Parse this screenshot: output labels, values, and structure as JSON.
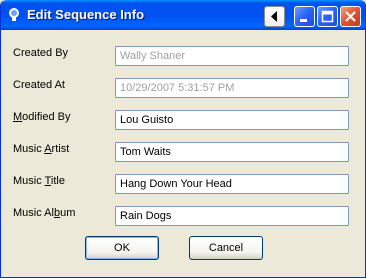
{
  "window": {
    "title": "Edit Sequence Info"
  },
  "titlebar_buttons": {
    "back_icon": "back-arrow-icon",
    "minimize_icon": "minimize-icon",
    "maximize_icon": "maximize-icon",
    "close_icon": "close-icon"
  },
  "fields": {
    "created_by": {
      "label": "Created By",
      "value": "Wally Shaner"
    },
    "created_at": {
      "label": "Created At",
      "value": "10/29/2007 5:31:57 PM"
    },
    "modified_by": {
      "label_pre": "",
      "label_key": "M",
      "label_post": "odified By",
      "value": "Lou Guisto"
    },
    "music_artist": {
      "label_pre": "Music ",
      "label_key": "A",
      "label_post": "rtist",
      "value": "Tom Waits"
    },
    "music_title": {
      "label_pre": "Music ",
      "label_key": "T",
      "label_post": "itle",
      "value": "Hang Down Your Head"
    },
    "music_album": {
      "label_pre": "Music Al",
      "label_key": "b",
      "label_post": "um",
      "value": "Rain Dogs"
    }
  },
  "buttons": {
    "ok_label": "OK",
    "cancel_label": "Cancel"
  },
  "colors": {
    "titlebar": "#0054e3",
    "window_bg": "#ece9d8",
    "readonly_text": "#a0a0a0",
    "field_border": "#7f9db9"
  }
}
